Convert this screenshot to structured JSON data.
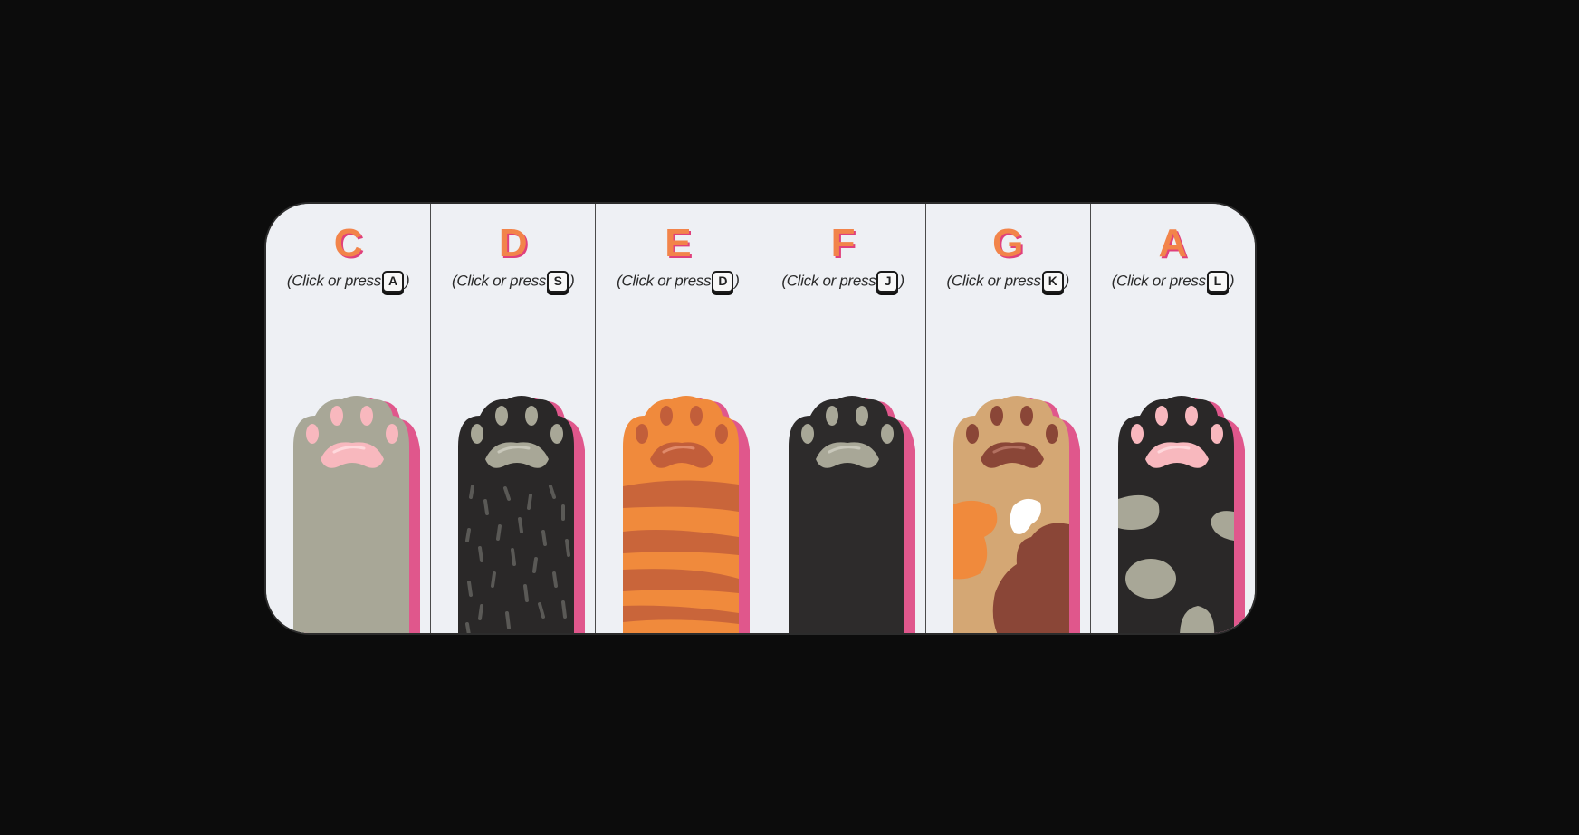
{
  "colors": {
    "background": "#0c0c0c",
    "panel": "#eef0f4",
    "note_text": "#f2844a",
    "note_shadow": "#e0407c",
    "paw_outline": "#e0578c"
  },
  "keys": [
    {
      "note": "C",
      "hint_prefix": "(Click or press",
      "shortcut": "A",
      "hint_suffix": ")",
      "paw_style": "gray-paw-icon",
      "fur": "#a8a797",
      "beans": "#f8b8be"
    },
    {
      "note": "D",
      "hint_prefix": "(Click or press",
      "shortcut": "S",
      "hint_suffix": ")",
      "paw_style": "black-furry-paw-icon",
      "fur": "#2a2828",
      "beans": "#a8a797"
    },
    {
      "note": "E",
      "hint_prefix": "(Click or press",
      "shortcut": "D",
      "hint_suffix": ")",
      "paw_style": "orange-tabby-paw-icon",
      "fur": "#f08a3c",
      "beans": "#c25e3a"
    },
    {
      "note": "F",
      "hint_prefix": "(Click or press",
      "shortcut": "J",
      "hint_suffix": ")",
      "paw_style": "black-paw-icon",
      "fur": "#2d2b2b",
      "beans": "#a8a797"
    },
    {
      "note": "G",
      "hint_prefix": "(Click or press",
      "shortcut": "K",
      "hint_suffix": ")",
      "paw_style": "calico-paw-icon",
      "fur": "#d4a774",
      "beans": "#8a4637"
    },
    {
      "note": "A",
      "hint_prefix": "(Click or press",
      "shortcut": "L",
      "hint_suffix": ")",
      "paw_style": "black-spotted-paw-icon",
      "fur": "#2a2828",
      "beans": "#f8b8be"
    }
  ]
}
